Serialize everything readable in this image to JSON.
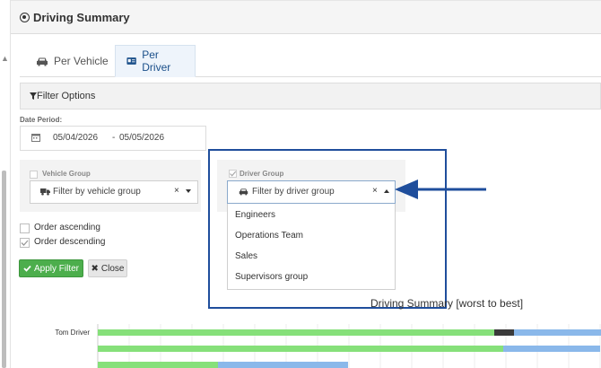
{
  "panel": {
    "title": "Driving Summary"
  },
  "tabs": [
    {
      "label": "Per Vehicle",
      "icon": "car-icon",
      "active": false
    },
    {
      "label": "Per Driver",
      "icon": "id-card-icon",
      "active": true
    }
  ],
  "filter_bar": {
    "label": "Filter Options"
  },
  "date_period": {
    "label": "Date Period:",
    "start": "05/04/2026",
    "separator": "-",
    "end": "05/05/2026"
  },
  "vehicle_group": {
    "label": "Vehicle Group",
    "placeholder": "Filter by vehicle group",
    "checked": false
  },
  "driver_group": {
    "label": "Driver Group",
    "placeholder": "Filter by driver group",
    "checked": true,
    "options": [
      "Engineers",
      "Operations Team",
      "Sales",
      "Supervisors group"
    ]
  },
  "order": {
    "ascending_label": "Order ascending",
    "descending_label": "Order descending",
    "selected": "descending"
  },
  "buttons": {
    "apply": "Apply Filter",
    "close": "Close"
  },
  "colors": {
    "accent": "#1f4e9c",
    "good": "#86e07a",
    "bad": "#3a3a3a",
    "neutral": "#8ab8ea",
    "apply": "#4cae4c"
  },
  "chart_data": {
    "type": "bar",
    "title": "Driving Summary [worst to best]",
    "categories": [
      "Tom Driver",
      "",
      ""
    ],
    "series": [
      {
        "values": [
          442,
          452,
          134
        ]
      },
      {
        "values": [
          22,
          0,
          0
        ]
      },
      {
        "values": [
          97,
          108,
          145
        ]
      }
    ]
  }
}
